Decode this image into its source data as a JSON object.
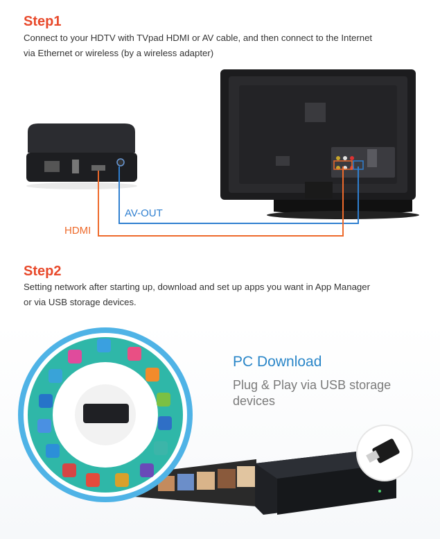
{
  "step1": {
    "title": "Step1",
    "line1": "Connect to your HDTV with TVpad HDMI or AV cable, and then connect to the Internet",
    "line2": "via  Ethernet  or  wireless (by a wireless adapter)"
  },
  "cables": {
    "av_label": "AV-OUT",
    "hdmi_label": "HDMI",
    "av_color": "#2f7fd0",
    "hdmi_color": "#ee6a2b"
  },
  "step2": {
    "title": "Step2",
    "line1": "Setting network after starting up, download and set up apps you want in App Manager",
    "line2": "or via USB storage devices."
  },
  "pc": {
    "title": "PC Download",
    "subtitle": "Plug & Play via USB storage devices"
  },
  "colors": {
    "accent_red": "#e8492b",
    "accent_blue": "#2a86c8",
    "wheel_teal": "#2fb7a8",
    "wheel_ring": "#4fb3e6"
  }
}
